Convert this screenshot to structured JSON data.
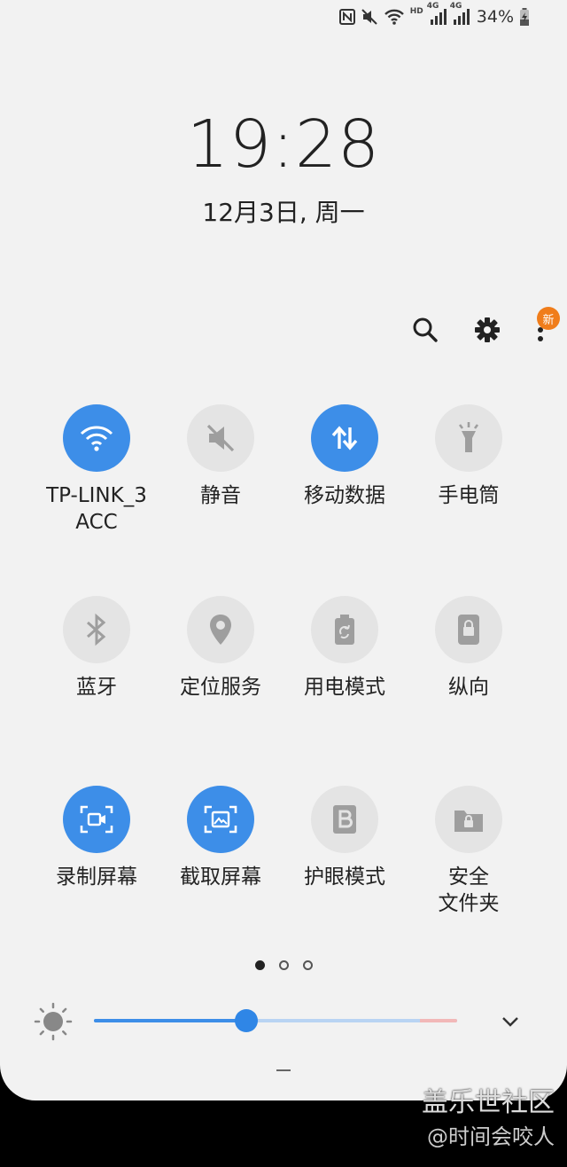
{
  "status_bar": {
    "icons": [
      "nfc-icon",
      "mute-icon",
      "wifi-icon",
      "hd-icon",
      "signal-4g-icon",
      "signal-4g-icon",
      "battery-charging-icon"
    ],
    "hd_label": "HD",
    "net1_label": "4G",
    "net2_label": "4G",
    "battery_percent": "34%"
  },
  "clock": {
    "time": "19:28",
    "date": "12月3日, 周一"
  },
  "toolbar": {
    "search_icon": "search-icon",
    "settings_icon": "gear-icon",
    "more_icon": "more-vert-icon",
    "badge_text": "新"
  },
  "tiles": [
    {
      "label": "TP-LINK_3\nACC",
      "icon": "wifi-icon",
      "active": true
    },
    {
      "label": "静音",
      "icon": "mute-icon",
      "active": false
    },
    {
      "label": "移动数据",
      "icon": "mobile-data-icon",
      "active": true
    },
    {
      "label": "手电筒",
      "icon": "flashlight-icon",
      "active": false
    },
    {
      "label": "蓝牙",
      "icon": "bluetooth-icon",
      "active": false
    },
    {
      "label": "定位服务",
      "icon": "location-icon",
      "active": false
    },
    {
      "label": "用电模式",
      "icon": "power-mode-icon",
      "active": false
    },
    {
      "label": "纵向",
      "icon": "portrait-lock-icon",
      "active": false
    },
    {
      "label": "录制屏幕",
      "icon": "screen-record-icon",
      "active": true
    },
    {
      "label": "截取屏幕",
      "icon": "screenshot-icon",
      "active": true
    },
    {
      "label": "护眼模式",
      "icon": "eye-comfort-icon",
      "active": false
    },
    {
      "label": "安全\n文件夹",
      "icon": "secure-folder-icon",
      "active": false
    }
  ],
  "pager": {
    "pages": 3,
    "active": 0
  },
  "brightness": {
    "level": 0.42
  },
  "colors": {
    "accent": "#3d8ee8",
    "inactive": "#e4e4e4",
    "background": "#f2f2f2",
    "badge": "#f07d1b"
  },
  "watermark": {
    "line1": "盖乐世社区",
    "line2": "@时间会咬人"
  }
}
